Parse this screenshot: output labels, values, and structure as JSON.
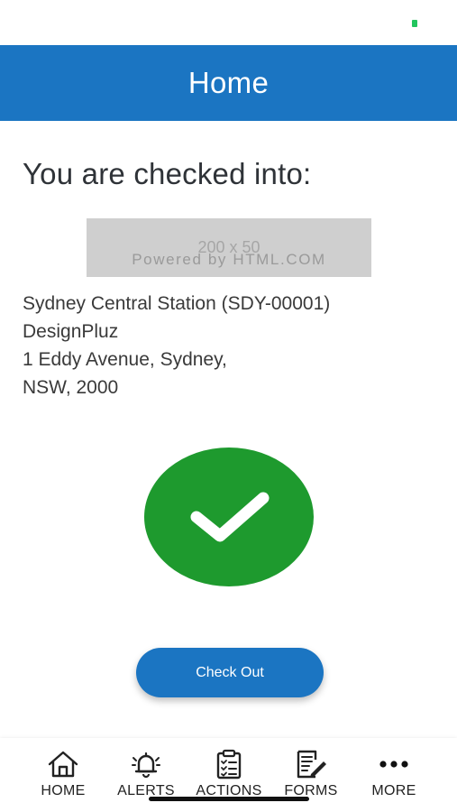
{
  "header": {
    "title": "Home"
  },
  "checkin": {
    "heading": "You are checked into:",
    "logo_placeholder": {
      "size_text": "200 x 50",
      "powered_text": "Powered by HTML.COM"
    },
    "site_name": "Sydney Central Station (SDY-00001)",
    "company": "DesignPluz",
    "address_line1": "1 Eddy Avenue, Sydney,",
    "address_line2": "NSW, 2000",
    "status_icon": "check-circle-icon",
    "checkout_label": "Check Out"
  },
  "tabs": [
    {
      "label": "HOME",
      "icon": "home-icon"
    },
    {
      "label": "ALERTS",
      "icon": "bell-icon"
    },
    {
      "label": "ACTIONS",
      "icon": "clipboard-icon"
    },
    {
      "label": "FORMS",
      "icon": "form-edit-icon"
    },
    {
      "label": "MORE",
      "icon": "more-dots-icon"
    }
  ],
  "colors": {
    "primary": "#1b75c2",
    "success": "#1e9a2e",
    "signal": "#22c55e"
  }
}
